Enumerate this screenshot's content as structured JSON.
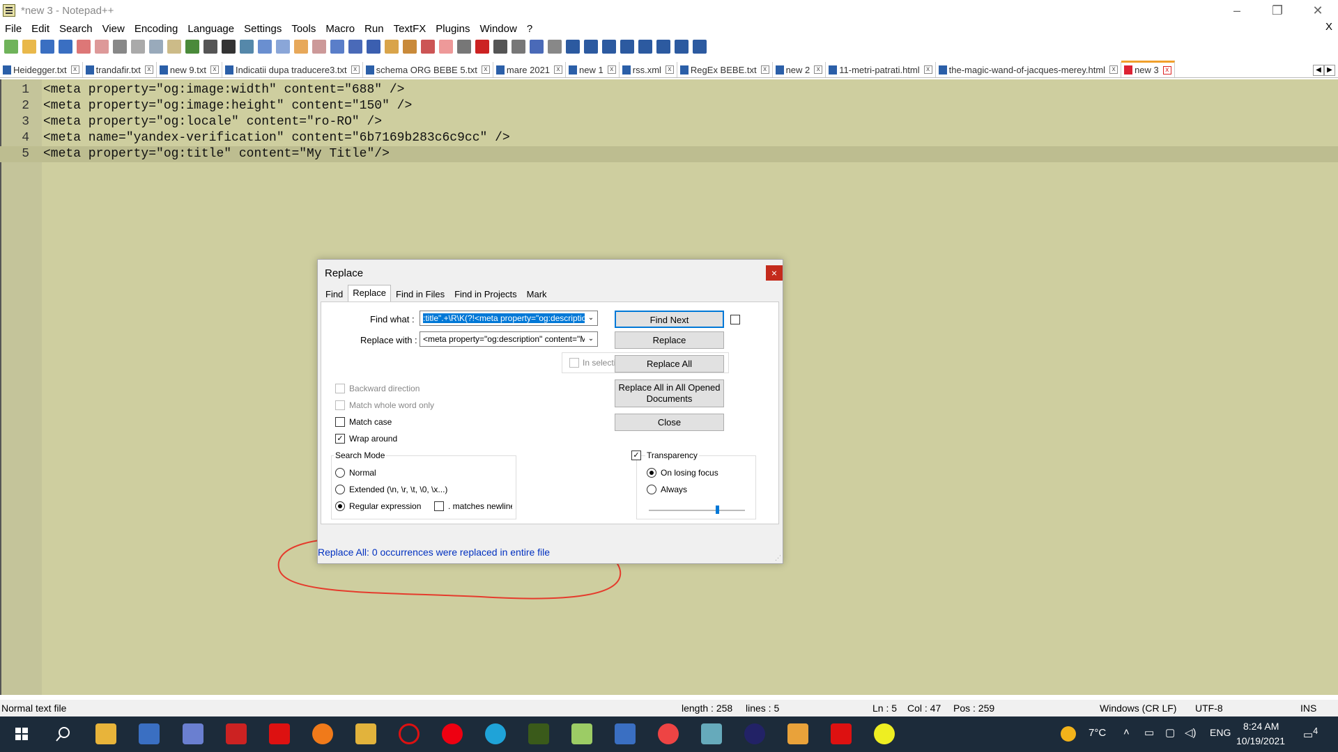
{
  "window": {
    "title": "*new 3 - Notepad++"
  },
  "menu": [
    "File",
    "Edit",
    "Search",
    "View",
    "Encoding",
    "Language",
    "Settings",
    "Tools",
    "Macro",
    "Run",
    "TextFX",
    "Plugins",
    "Window",
    "?"
  ],
  "menu_close": "X",
  "tabs": [
    "Heidegger.txt",
    "trandafir.txt",
    "new 9.txt",
    "Indicatii dupa traducere3.txt",
    "schema ORG BEBE 5.txt",
    "mare 2021",
    "new 1",
    "rss.xml",
    "RegEx BEBE.txt",
    "new 2",
    "11-metri-patrati.html",
    "the-magic-wand-of-jacques-merey.html",
    "new 3"
  ],
  "editor": {
    "lines": [
      {
        "n": "1",
        "text": "<meta property=\"og:image:width\" content=\"688\" />"
      },
      {
        "n": "2",
        "text": "<meta property=\"og:image:height\" content=\"150\" />"
      },
      {
        "n": "3",
        "text": "<meta property=\"og:locale\" content=\"ro-RO\" />"
      },
      {
        "n": "4",
        "text": "<meta name=\"yandex-verification\" content=\"6b7169b283c6c9cc\" />"
      },
      {
        "n": "5",
        "text": "<meta property=\"og:title\" content=\"My Title\"/>"
      }
    ]
  },
  "dialog": {
    "title": "Replace",
    "close": "×",
    "tabs": [
      "Find",
      "Replace",
      "Find in Files",
      "Find in Projects",
      "Mark"
    ],
    "find_label": "Find what :",
    "find_value": ":title\".+\\R\\K(?!<meta property=\"og:description\")",
    "replace_label": "Replace with :",
    "replace_value": "<meta property=\"og:description\" content=\"My de",
    "in_selection": "In selection",
    "buttons": {
      "find_next": "Find Next",
      "replace": "Replace",
      "replace_all": "Replace All",
      "replace_all_opened": "Replace All in All Opened Documents",
      "close": "Close"
    },
    "options": {
      "backward": "Backward direction",
      "whole_word": "Match whole word only",
      "match_case": "Match case",
      "wrap": "Wrap around"
    },
    "search_mode": {
      "title": "Search Mode",
      "normal": "Normal",
      "extended": "Extended (\\n, \\r, \\t, \\0, \\x...)",
      "regex": "Regular expression",
      "newline": ". matches newline"
    },
    "transparency": {
      "title": "Transparency",
      "on_losing": "On losing focus",
      "always": "Always"
    },
    "status": "Replace All: 0 occurrences were replaced in entire file"
  },
  "statusbar": {
    "type": "Normal text file",
    "length": "length : 258",
    "lines": "lines : 5",
    "ln": "Ln : 5",
    "col": "Col : 47",
    "pos": "Pos : 259",
    "eol": "Windows (CR LF)",
    "enc": "UTF-8",
    "ins": "INS"
  },
  "taskbar": {
    "weather": "7°C",
    "lang": "ENG",
    "time": "8:24 AM",
    "date": "10/19/2021",
    "notif": "4"
  }
}
